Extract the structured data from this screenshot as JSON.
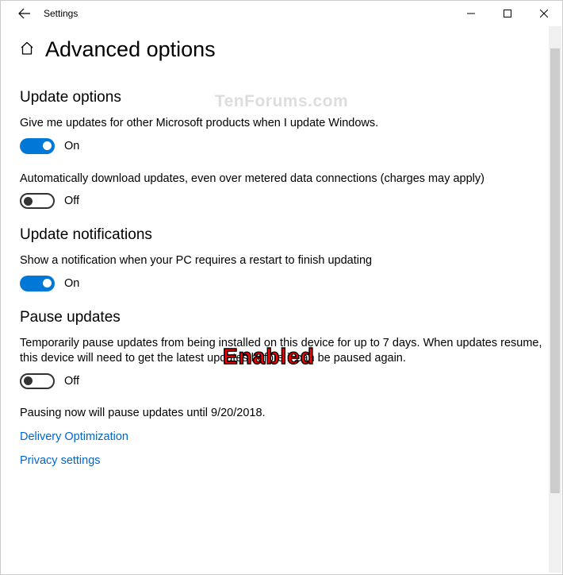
{
  "titlebar": {
    "title": "Settings"
  },
  "page": {
    "title": "Advanced options"
  },
  "watermark": "TenForums.com",
  "overlay": "Enabled",
  "sections": {
    "updateOptions": {
      "title": "Update options",
      "setting1": {
        "text": "Give me updates for other Microsoft products when I update Windows.",
        "state": "On"
      },
      "setting2": {
        "text": "Automatically download updates, even over metered data connections (charges may apply)",
        "state": "Off"
      }
    },
    "updateNotifications": {
      "title": "Update notifications",
      "setting1": {
        "text": "Show a notification when your PC requires a restart to finish updating",
        "state": "On"
      }
    },
    "pauseUpdates": {
      "title": "Pause updates",
      "setting1": {
        "text": "Temporarily pause updates from being installed on this device for up to 7 days. When updates resume, this device will need to get the latest updates before it can be paused again.",
        "state": "Off"
      },
      "info": "Pausing now will pause updates until 9/20/2018."
    }
  },
  "links": {
    "delivery": "Delivery Optimization",
    "privacy": "Privacy settings"
  }
}
